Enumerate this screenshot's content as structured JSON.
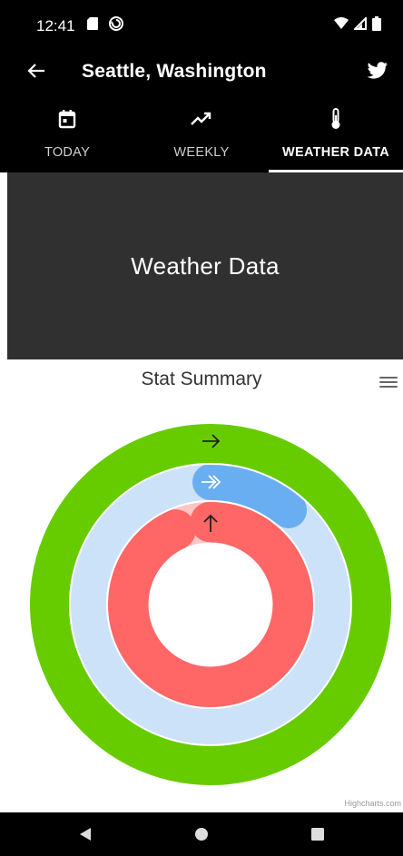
{
  "status_bar": {
    "time": "12:41",
    "icons": [
      "sd-card-icon",
      "sync-icon",
      "wifi-icon",
      "signal-icon",
      "battery-icon"
    ]
  },
  "app_bar": {
    "title": "Seattle, Washington",
    "back_icon": "arrow-left-icon",
    "share_icon": "twitter-icon"
  },
  "tabs": [
    {
      "label": "TODAY",
      "icon": "calendar-icon",
      "active": false
    },
    {
      "label": "WEEKLY",
      "icon": "trending-up-icon",
      "active": false
    },
    {
      "label": "WEATHER DATA",
      "icon": "thermometer-icon",
      "active": true
    }
  ],
  "hero": {
    "title": "Weather Data"
  },
  "chart": {
    "title": "Stat Summary",
    "menu_icon": "hamburger-menu-icon",
    "credits": "Highcharts.com"
  },
  "chart_data": {
    "type": "solidgauge",
    "title": "Stat Summary",
    "series": [
      {
        "ring": "outer",
        "color": "#66cc00",
        "track_color": "#66cc00",
        "fraction": 1.0,
        "icon": "arrow-right-icon"
      },
      {
        "ring": "middle",
        "color": "#6aaef2",
        "track_color": "#cce2f8",
        "fraction": 0.11,
        "icon": "double-arrow-right-icon"
      },
      {
        "ring": "inner",
        "color": "#ff6666",
        "track_color": "#ffc6c6",
        "fraction": 0.93,
        "icon": "arrow-up-icon"
      }
    ]
  },
  "nav_bar": {
    "buttons": [
      "back-triangle-icon",
      "home-circle-icon",
      "recents-square-icon"
    ]
  }
}
